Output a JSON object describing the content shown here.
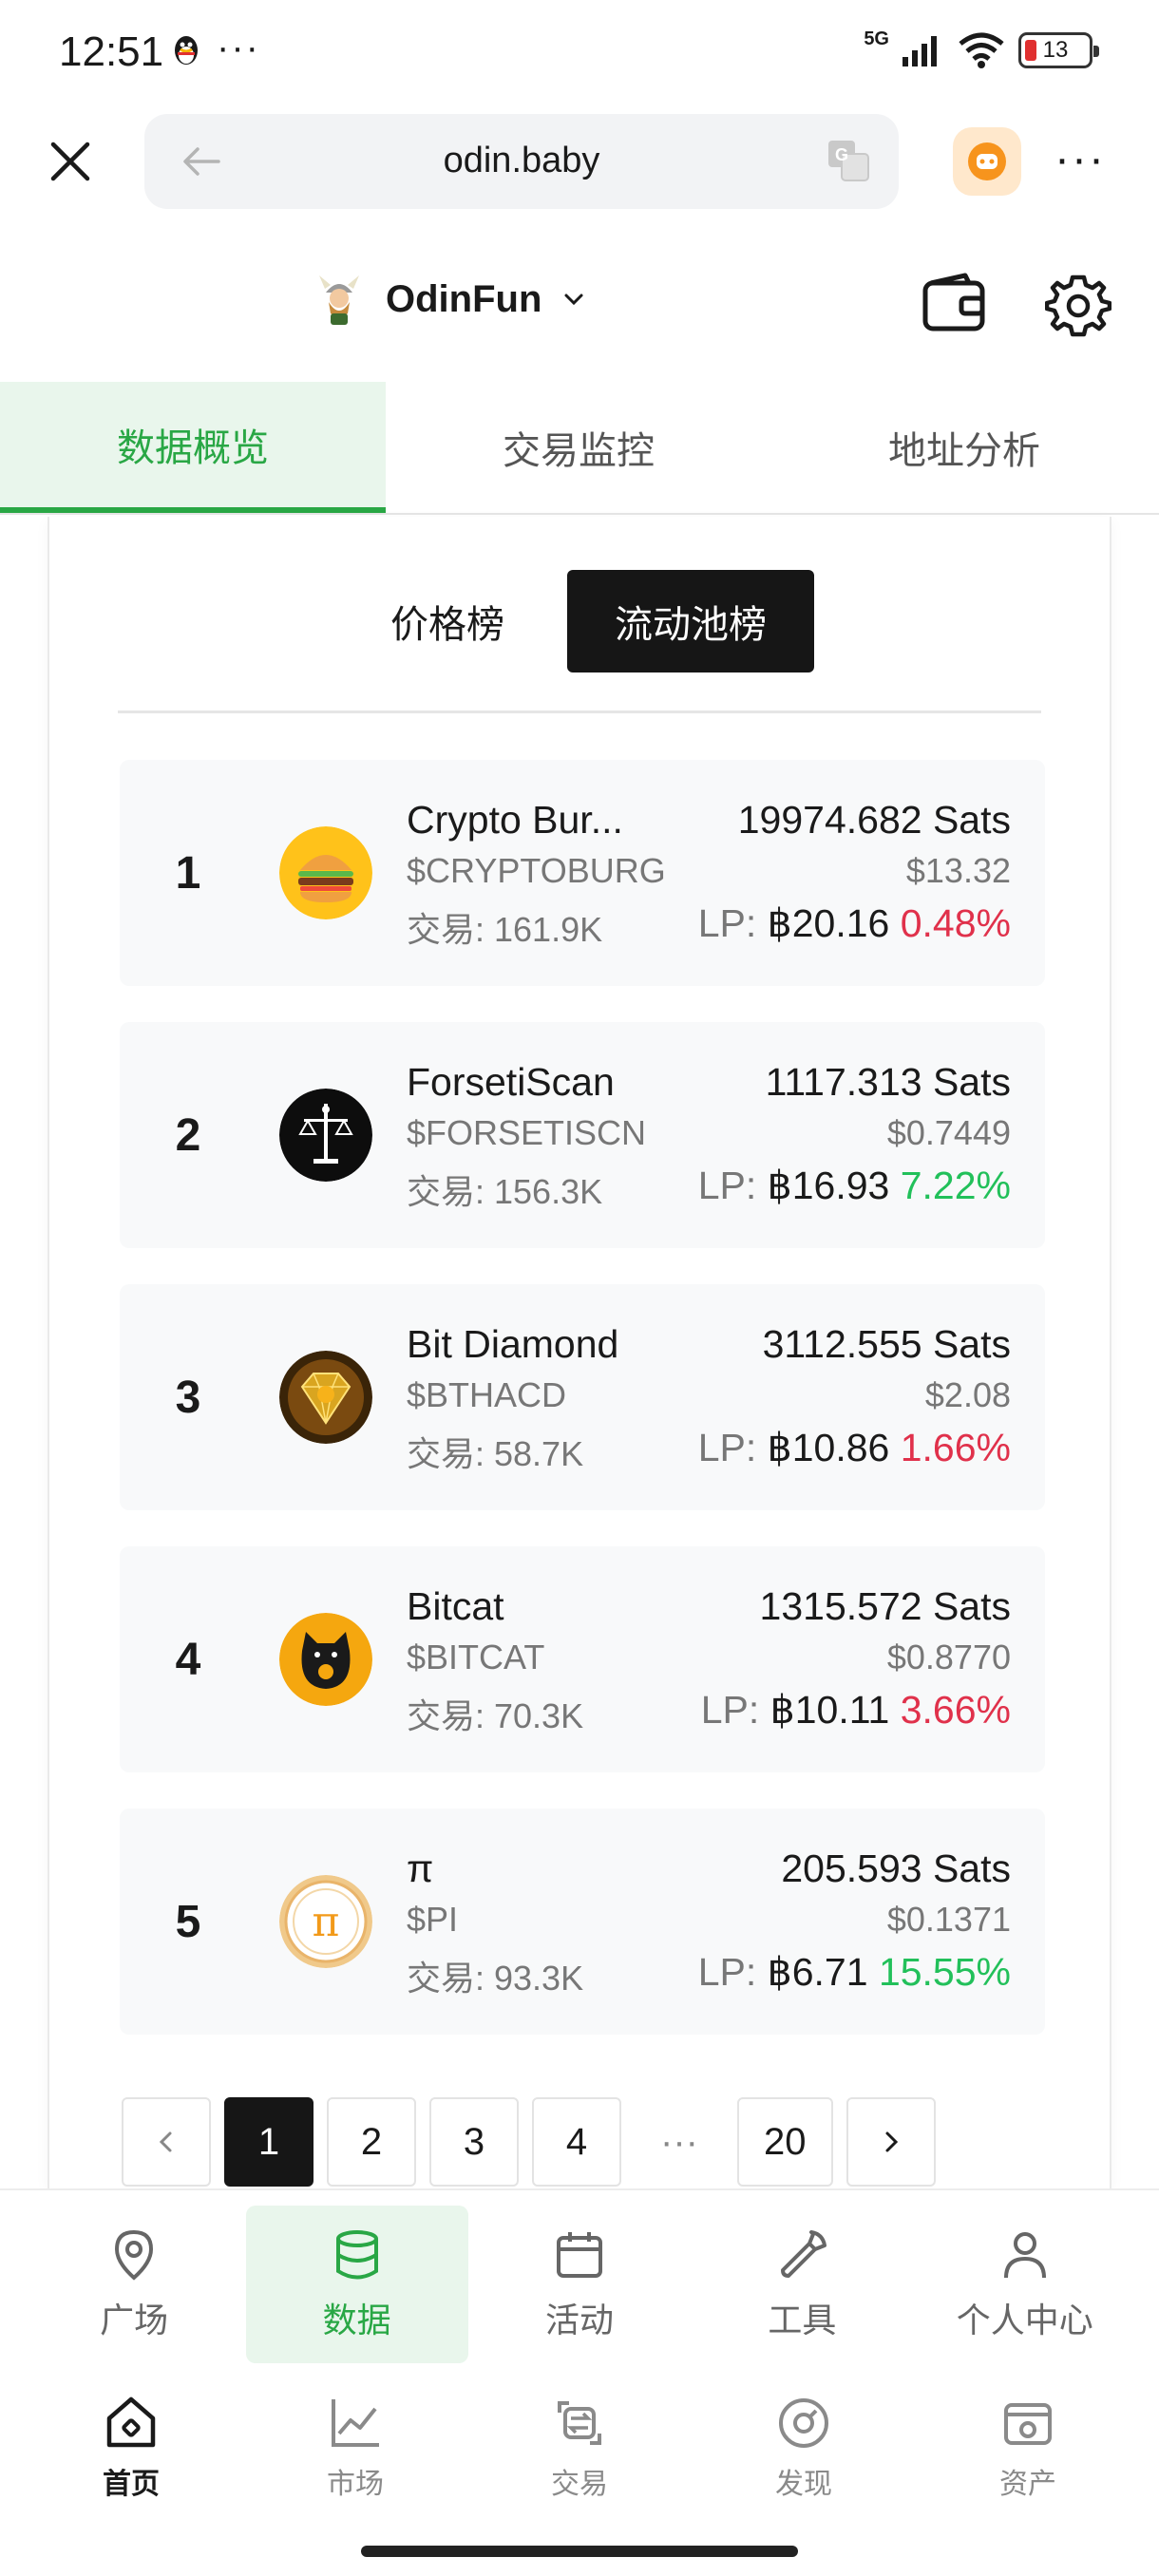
{
  "status_bar": {
    "time": "12:51",
    "dots": "···",
    "network": "5G",
    "battery": "13"
  },
  "browser": {
    "url": "odin.baby",
    "more": "···"
  },
  "header": {
    "brand": "OdinFun"
  },
  "tabs": [
    {
      "label": "数据概览",
      "active": true
    },
    {
      "label": "交易监控",
      "active": false
    },
    {
      "label": "地址分析",
      "active": false
    }
  ],
  "segment": [
    {
      "label": "价格榜",
      "active": false
    },
    {
      "label": "流动池榜",
      "active": true
    }
  ],
  "tokens": [
    {
      "rank": "1",
      "name": "Crypto Bur...",
      "ticker": "$CRYPTOBURG",
      "volume": "交易: 161.9K",
      "sats": "19974.682 Sats",
      "usd": "$13.32",
      "lp_label": "LP:",
      "lp_value": "฿20.16",
      "change": "0.48%",
      "change_dir": "down"
    },
    {
      "rank": "2",
      "name": "ForsetiScan",
      "ticker": "$FORSETISCN",
      "volume": "交易: 156.3K",
      "sats": "1117.313 Sats",
      "usd": "$0.7449",
      "lp_label": "LP:",
      "lp_value": "฿16.93",
      "change": "7.22%",
      "change_dir": "up"
    },
    {
      "rank": "3",
      "name": "Bit Diamond",
      "ticker": "$BTHACD",
      "volume": "交易: 58.7K",
      "sats": "3112.555 Sats",
      "usd": "$2.08",
      "lp_label": "LP:",
      "lp_value": "฿10.86",
      "change": "1.66%",
      "change_dir": "down"
    },
    {
      "rank": "4",
      "name": "Bitcat",
      "ticker": "$BITCAT",
      "volume": "交易: 70.3K",
      "sats": "1315.572 Sats",
      "usd": "$0.8770",
      "lp_label": "LP:",
      "lp_value": "฿10.11",
      "change": "3.66%",
      "change_dir": "down"
    },
    {
      "rank": "5",
      "name": "π",
      "ticker": "$PI",
      "volume": "交易: 93.3K",
      "sats": "205.593 Sats",
      "usd": "$0.1371",
      "lp_label": "LP:",
      "lp_value": "฿6.71",
      "change": "15.55%",
      "change_dir": "up"
    }
  ],
  "pagination": {
    "pages": [
      "1",
      "2",
      "3",
      "4"
    ],
    "ellipsis": "···",
    "last": "20",
    "current": "1"
  },
  "app_nav": [
    {
      "label": "广场",
      "icon": "location-pin-icon",
      "active": false
    },
    {
      "label": "数据",
      "icon": "database-icon",
      "active": true
    },
    {
      "label": "活动",
      "icon": "calendar-icon",
      "active": false
    },
    {
      "label": "工具",
      "icon": "wrench-icon",
      "active": false
    },
    {
      "label": "个人中心",
      "icon": "user-icon",
      "active": false
    }
  ],
  "browser_nav": [
    {
      "label": "首页",
      "icon": "home-icon",
      "active": true
    },
    {
      "label": "市场",
      "icon": "chart-icon",
      "active": false
    },
    {
      "label": "交易",
      "icon": "swap-icon",
      "active": false
    },
    {
      "label": "发现",
      "icon": "compass-icon",
      "active": false
    },
    {
      "label": "资产",
      "icon": "wallet-icon",
      "active": false
    }
  ],
  "colors": {
    "accent": "#29a745",
    "negative": "#e0314b",
    "positive": "#22c05a",
    "dark": "#161616"
  }
}
